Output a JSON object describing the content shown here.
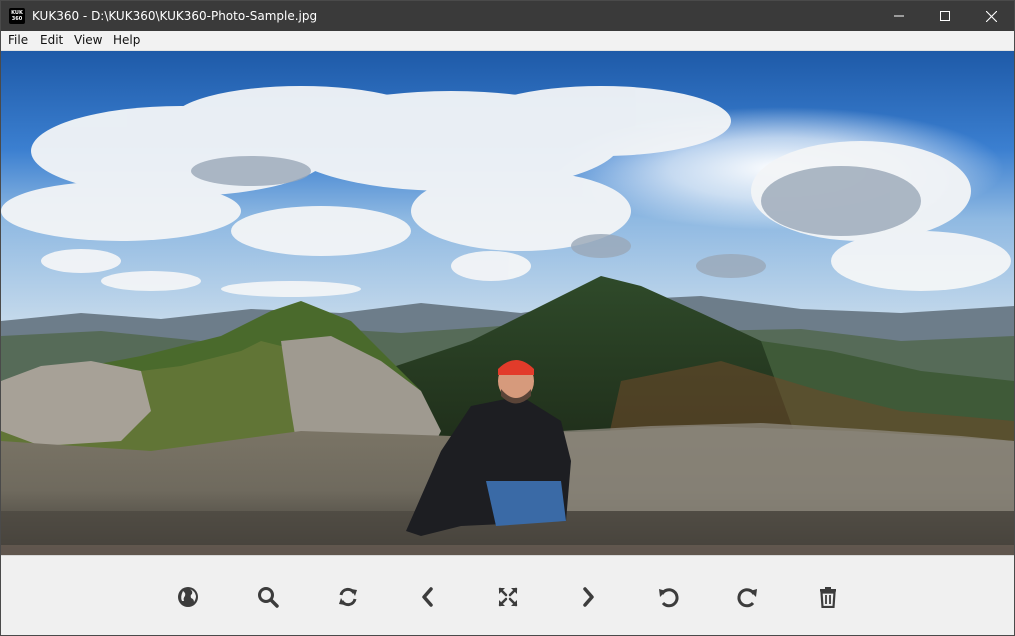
{
  "window": {
    "title": "KUK360 - D:\\KUK360\\KUK360-Photo-Sample.jpg",
    "app_icon_line1": "KUK",
    "app_icon_line2": "360",
    "minimize_icon": "minimize-icon",
    "maximize_icon": "maximize-icon",
    "close_icon": "close-icon"
  },
  "menu": {
    "items": [
      {
        "label": "File"
      },
      {
        "label": "Edit"
      },
      {
        "label": "View"
      },
      {
        "label": "Help"
      }
    ]
  },
  "viewer": {
    "image_subject": "equirectangular 360 panorama of mountain ridge with hiker"
  },
  "toolbar": {
    "tools": [
      {
        "icon": "globe-icon"
      },
      {
        "icon": "search-icon"
      },
      {
        "icon": "refresh-icon"
      },
      {
        "icon": "chevron-left-icon"
      },
      {
        "icon": "fullscreen-icon"
      },
      {
        "icon": "chevron-right-icon"
      },
      {
        "icon": "rotate-left-icon"
      },
      {
        "icon": "rotate-right-icon"
      },
      {
        "icon": "trash-icon"
      }
    ],
    "icon_color": "#3c3c3c"
  },
  "colors": {
    "titlebar": "#3a3a3a",
    "menubar": "#f2f2f2",
    "toolbar": "#f0f0f0"
  }
}
